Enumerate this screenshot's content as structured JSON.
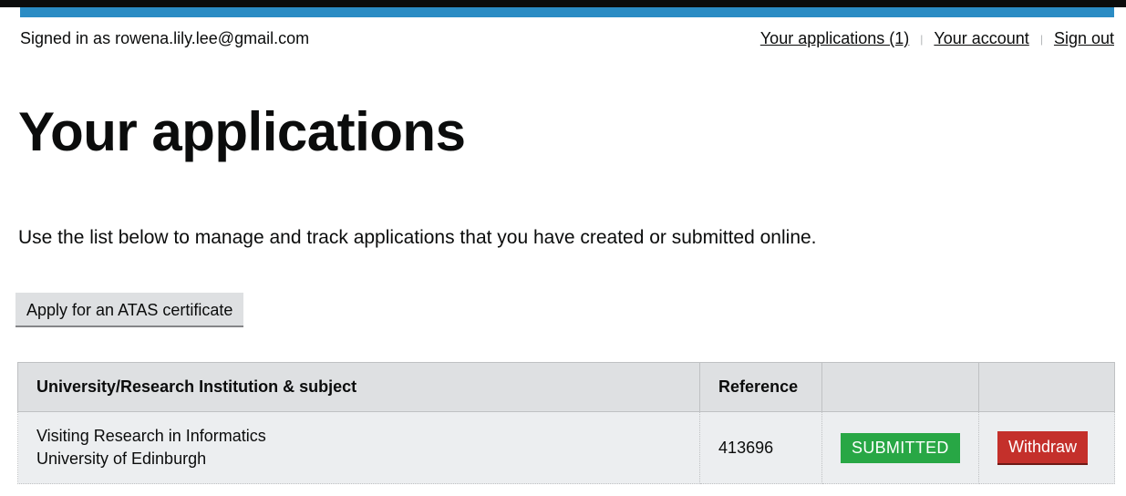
{
  "header": {
    "signed_in_text": "Signed in as rowena.lily.lee@gmail.com",
    "nav": {
      "applications": "Your applications (1)",
      "account": "Your account",
      "sign_out": "Sign out",
      "separator": "|"
    }
  },
  "main": {
    "title": "Your applications",
    "intro": "Use the list below to manage and track applications that you have created or submitted online.",
    "apply_button": "Apply for an ATAS certificate"
  },
  "table": {
    "headers": [
      "University/Research Institution & subject",
      "Reference",
      "",
      ""
    ],
    "rows": [
      {
        "subject": "Visiting Research in Informatics",
        "institution": "University of Edinburgh",
        "reference": "413696",
        "status": "SUBMITTED",
        "action": "Withdraw"
      }
    ]
  },
  "colors": {
    "brand_blue": "#2b8cc4",
    "status_submitted": "#28a745",
    "withdraw_red": "#c4302b"
  }
}
